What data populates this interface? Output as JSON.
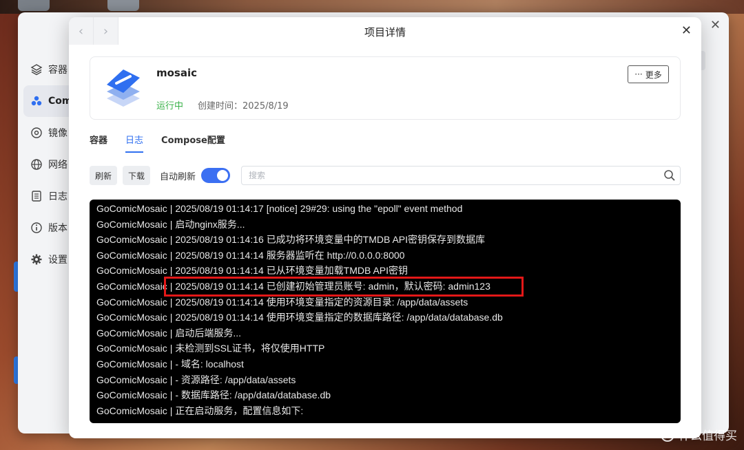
{
  "app": {
    "sidebar": [
      {
        "label": "容器",
        "icon": "layers-icon"
      },
      {
        "label": "Com",
        "icon": "compose-icon",
        "active": true
      },
      {
        "label": "镜像",
        "icon": "image-icon"
      },
      {
        "label": "网络",
        "icon": "globe-icon"
      },
      {
        "label": "日志",
        "icon": "log-icon"
      },
      {
        "label": "版本",
        "icon": "info-icon"
      },
      {
        "label": "设置",
        "icon": "gear-icon"
      }
    ]
  },
  "modal": {
    "title": "项目详情",
    "back": "‹",
    "forward": "›",
    "close": "✕"
  },
  "project": {
    "name": "mosaic",
    "status": "运行中",
    "created": "创建时间：2025/8/19",
    "more_label": "更多",
    "more_dots": "···"
  },
  "tabs": [
    {
      "label": "容器"
    },
    {
      "label": "日志",
      "active": true
    },
    {
      "label": "Compose配置"
    }
  ],
  "toolbar": {
    "refresh": "刷新",
    "download": "下载",
    "auto_refresh": "自动刷新",
    "auto_refresh_on": true,
    "search_placeholder": "搜索"
  },
  "logs": [
    {
      "src": "GoComicMosaic",
      "msg": "2025/08/19 01:14:17 [notice] 29#29: using the \"epoll\" event method"
    },
    {
      "src": "GoComicMosaic",
      "msg": "启动nginx服务..."
    },
    {
      "src": "GoComicMosaic",
      "msg": "2025/08/19 01:14:16 已成功将环境变量中的TMDB API密钥保存到数据库"
    },
    {
      "src": "GoComicMosaic",
      "msg": "2025/08/19 01:14:14 服务器监听在 http://0.0.0.0:8000"
    },
    {
      "src": "GoComicMosaic",
      "msg": "2025/08/19 01:14:14 已从环境变量加载TMDB API密钥"
    },
    {
      "src": "GoComicMosaic",
      "msg": "2025/08/19 01:14:14 已创建初始管理员账号: admin，默认密码: admin123"
    },
    {
      "src": "GoComicMosaic",
      "msg": "2025/08/19 01:14:14 使用环境变量指定的资源目录: /app/data/assets"
    },
    {
      "src": "GoComicMosaic",
      "msg": "2025/08/19 01:14:14 使用环境变量指定的数据库路径: /app/data/database.db"
    },
    {
      "src": "GoComicMosaic",
      "msg": "启动后端服务..."
    },
    {
      "src": "GoComicMosaic",
      "msg": "未检测到SSL证书，将仅使用HTTP"
    },
    {
      "src": "GoComicMosaic",
      "msg": "- 域名: localhost"
    },
    {
      "src": "GoComicMosaic",
      "msg": "- 资源路径: /app/data/assets"
    },
    {
      "src": "GoComicMosaic",
      "msg": "- 数据库路径: /app/data/database.db"
    },
    {
      "src": "GoComicMosaic",
      "msg": "正在启动服务，配置信息如下:"
    }
  ],
  "watermark": {
    "badge": "值",
    "text": "什么值得买"
  },
  "colors": {
    "accent": "#2f6ff0",
    "running": "#3bb24a",
    "highlight": "#e31818",
    "log_bg": "#000000"
  }
}
